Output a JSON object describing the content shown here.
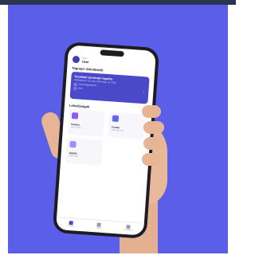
{
  "app": {
    "header": {
      "greeting": "Szia!",
      "name": "User"
    },
    "events_section": {
      "title": "Tegnap! Jelentkezik"
    },
    "event_card": {
      "title": "Szombati sportnapi regattra",
      "subtitle": "Kaféhaztam: ma, társ, körbe igaz, az 2024",
      "date": "2024 Augusztus 30",
      "time": "8:00"
    },
    "quick_section": {
      "title": "Lehetőségek"
    },
    "tiles": [
      {
        "title": "Kedves",
        "subtitle": "Igy és lélek",
        "color": "#8b5cf6"
      },
      {
        "title": "Fontos",
        "subtitle": "Szia, egy ima",
        "color": "#6366f1"
      },
      {
        "title": "Ingatla",
        "subtitle": "Nem hirek",
        "color": "#a78bfa"
      }
    ],
    "tabbar": [
      {
        "label": "Kezdőlap",
        "color": "#4a49c9"
      },
      {
        "label": "Naptár",
        "color": "#9a9ab0"
      },
      {
        "label": "Események",
        "color": "#9a9ab0"
      }
    ]
  },
  "colors": {
    "background": "#5b5ee8",
    "accent": "#4a49c9",
    "phone": "#1c1c22"
  }
}
